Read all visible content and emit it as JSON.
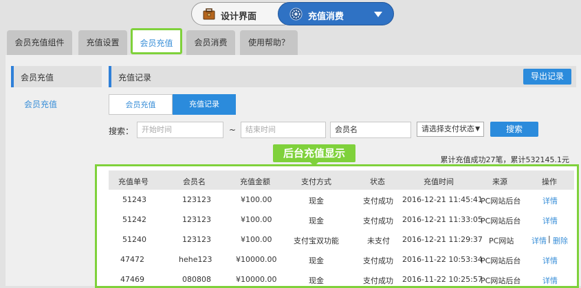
{
  "switcher": {
    "design_label": "设计界面",
    "recharge_label": "充值消费"
  },
  "tabs": [
    {
      "label": "会员充值组件"
    },
    {
      "label": "充值设置"
    },
    {
      "label": "会员充值"
    },
    {
      "label": "会员消费"
    },
    {
      "label": "使用帮助？"
    }
  ],
  "sidebar": {
    "header": "会员充值",
    "item": "会员充值"
  },
  "content": {
    "title": "充值记录",
    "export_label": "导出记录",
    "subtabs": [
      "会员充值",
      "充值记录"
    ]
  },
  "search": {
    "label": "搜索：",
    "start_placeholder": "开始时间",
    "tilde": "~",
    "end_placeholder": "结束时间",
    "member_value": "会员名",
    "status_select": "请选择支付状态",
    "button": "搜索"
  },
  "callout": "后台充值显示",
  "summary": "累计充值成功27笔，累计532145.1元",
  "table": {
    "headers": [
      "充值单号",
      "会员名",
      "充值金额",
      "支付方式",
      "状态",
      "充值时间",
      "来源",
      "操作"
    ],
    "rows": [
      {
        "id": "51243",
        "member": "123123",
        "amount": "¥100.00",
        "method": "现金",
        "status": "支付成功",
        "time": "2016-12-21 11:45:41",
        "source": "PC网站后台",
        "actions": [
          "详情"
        ]
      },
      {
        "id": "51242",
        "member": "123123",
        "amount": "¥100.00",
        "method": "现金",
        "status": "支付成功",
        "time": "2016-12-21 11:33:05",
        "source": "PC网站后台",
        "actions": [
          "详情"
        ]
      },
      {
        "id": "51240",
        "member": "123123",
        "amount": "¥100.00",
        "method": "支付宝双功能",
        "status": "未支付",
        "time": "2016-12-21 11:29:37",
        "source": "PC网站",
        "actions": [
          "详情",
          "删除"
        ]
      },
      {
        "id": "47472",
        "member": "hehe123",
        "amount": "¥10000.00",
        "method": "现金",
        "status": "支付成功",
        "time": "2016-11-22 10:53:34",
        "source": "PC网站后台",
        "actions": [
          "详情"
        ]
      },
      {
        "id": "47469",
        "member": "080808",
        "amount": "¥10000.00",
        "method": "现金",
        "status": "支付成功",
        "time": "2016-11-22 10:25:57",
        "source": "PC网站后台",
        "actions": [
          "详情"
        ]
      }
    ]
  },
  "colors": {
    "accent_blue": "#2b8bdc",
    "highlight_green": "#7fd13b"
  }
}
